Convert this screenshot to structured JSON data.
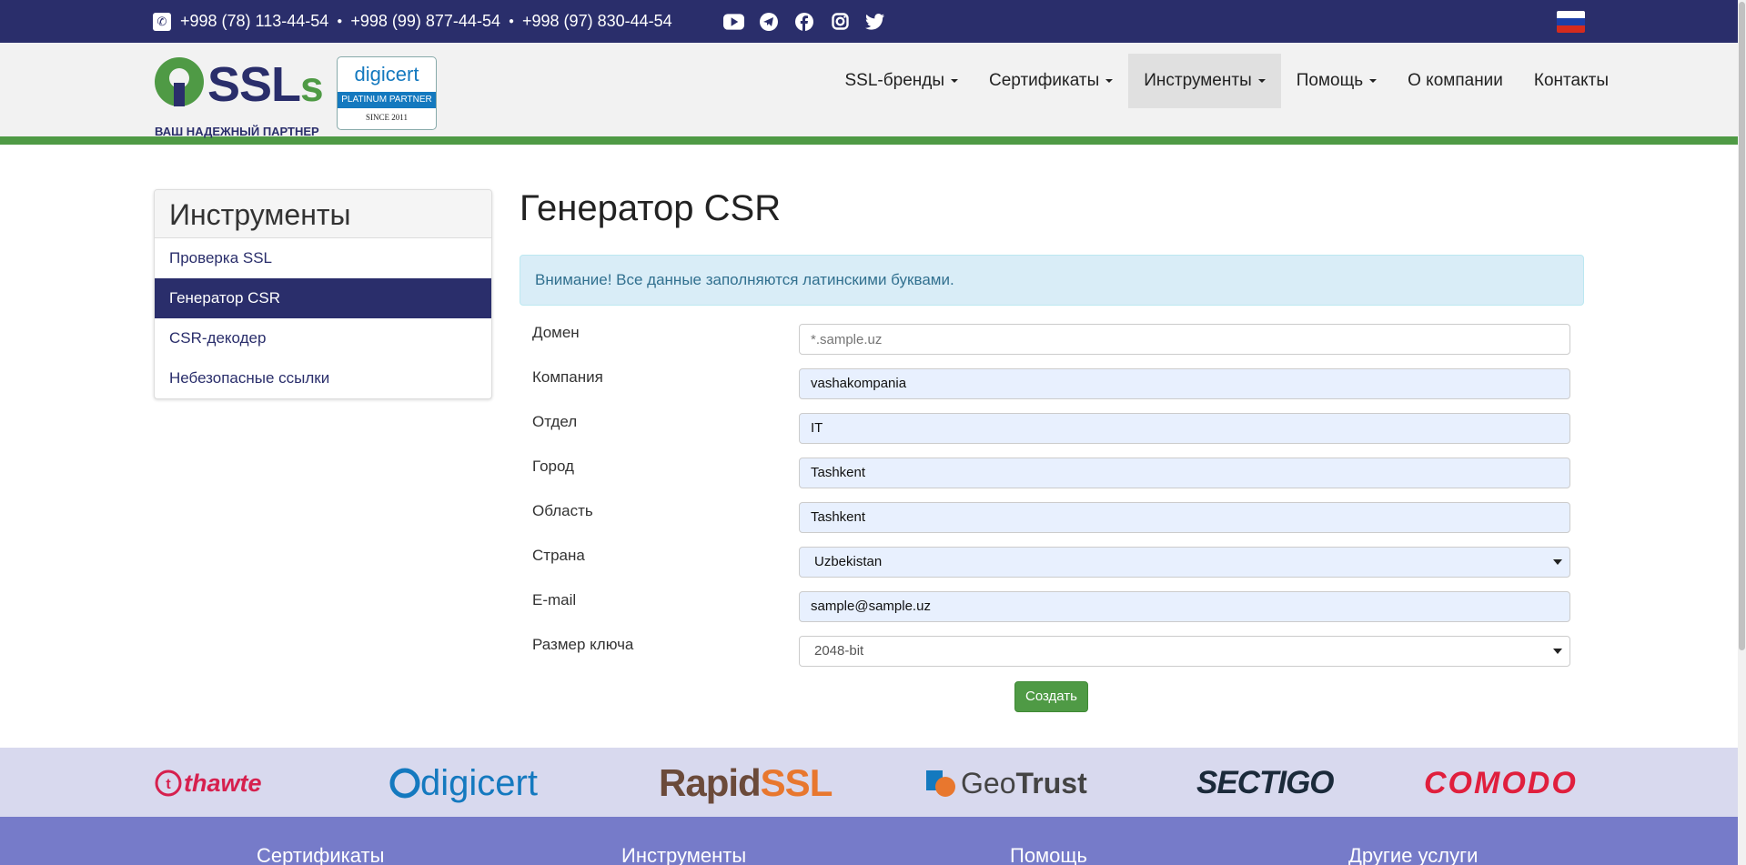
{
  "topbar": {
    "phones": [
      "+998 (78) 113-44-54",
      "+998 (99) 877-44-54",
      "+998 (97) 830-44-54"
    ],
    "socials": [
      "youtube-icon",
      "telegram-icon",
      "facebook-icon",
      "instagram-icon",
      "twitter-icon"
    ],
    "language_flag": "russian-flag"
  },
  "header": {
    "logo_text": "SSLs",
    "tagline": "ВАШ НАДЕЖНЫЙ ПАРТНЕР",
    "badge": {
      "brand": "digicert",
      "level": "PLATINUM PARTNER",
      "since": "SINCE 2011"
    },
    "nav": [
      {
        "label": "SSL-бренды",
        "dropdown": true
      },
      {
        "label": "Сертификаты",
        "dropdown": true
      },
      {
        "label": "Инструменты",
        "dropdown": true,
        "active": true
      },
      {
        "label": "Помощь",
        "dropdown": true
      },
      {
        "label": "О компании",
        "dropdown": false
      },
      {
        "label": "Контакты",
        "dropdown": false
      }
    ]
  },
  "sidebar": {
    "title": "Инструменты",
    "links": [
      {
        "label": "Проверка SSL"
      },
      {
        "label": "Генератор CSR",
        "active": true
      },
      {
        "label": "CSR-декодер"
      },
      {
        "label": "Небезопасные ссылки"
      }
    ]
  },
  "main": {
    "title": "Генератор CSR",
    "alert": "Внимание! Все данные заполняются латинскими буквами.",
    "fields": [
      {
        "label": "Домен",
        "value": "",
        "placeholder": "*.sample.uz",
        "type": "input"
      },
      {
        "label": "Компания",
        "value": "vashakompania",
        "type": "input"
      },
      {
        "label": "Отдел",
        "value": "IT",
        "type": "input"
      },
      {
        "label": "Город",
        "value": "Tashkent",
        "type": "input"
      },
      {
        "label": "Область",
        "value": "Tashkent",
        "type": "input"
      },
      {
        "label": "Страна",
        "value": "Uzbekistan",
        "type": "select"
      },
      {
        "label": "E-mail",
        "value": "sample@sample.uz",
        "type": "input"
      },
      {
        "label": "Размер ключа",
        "value": "2048-bit",
        "type": "select"
      }
    ],
    "submit_label": "Создать"
  },
  "partners": [
    "thawte",
    "digicert",
    "RapidSSL",
    "GeoTrust",
    "SECTIGO",
    "COMODO"
  ],
  "footer": {
    "columns": [
      "Сертификаты",
      "Инструменты",
      "Помощь",
      "Другие услуги"
    ]
  },
  "colors": {
    "navy": "#2a2e6b",
    "green": "#4f9a45",
    "footer": "#767bc9",
    "partners_bg": "#d8d9ee"
  }
}
